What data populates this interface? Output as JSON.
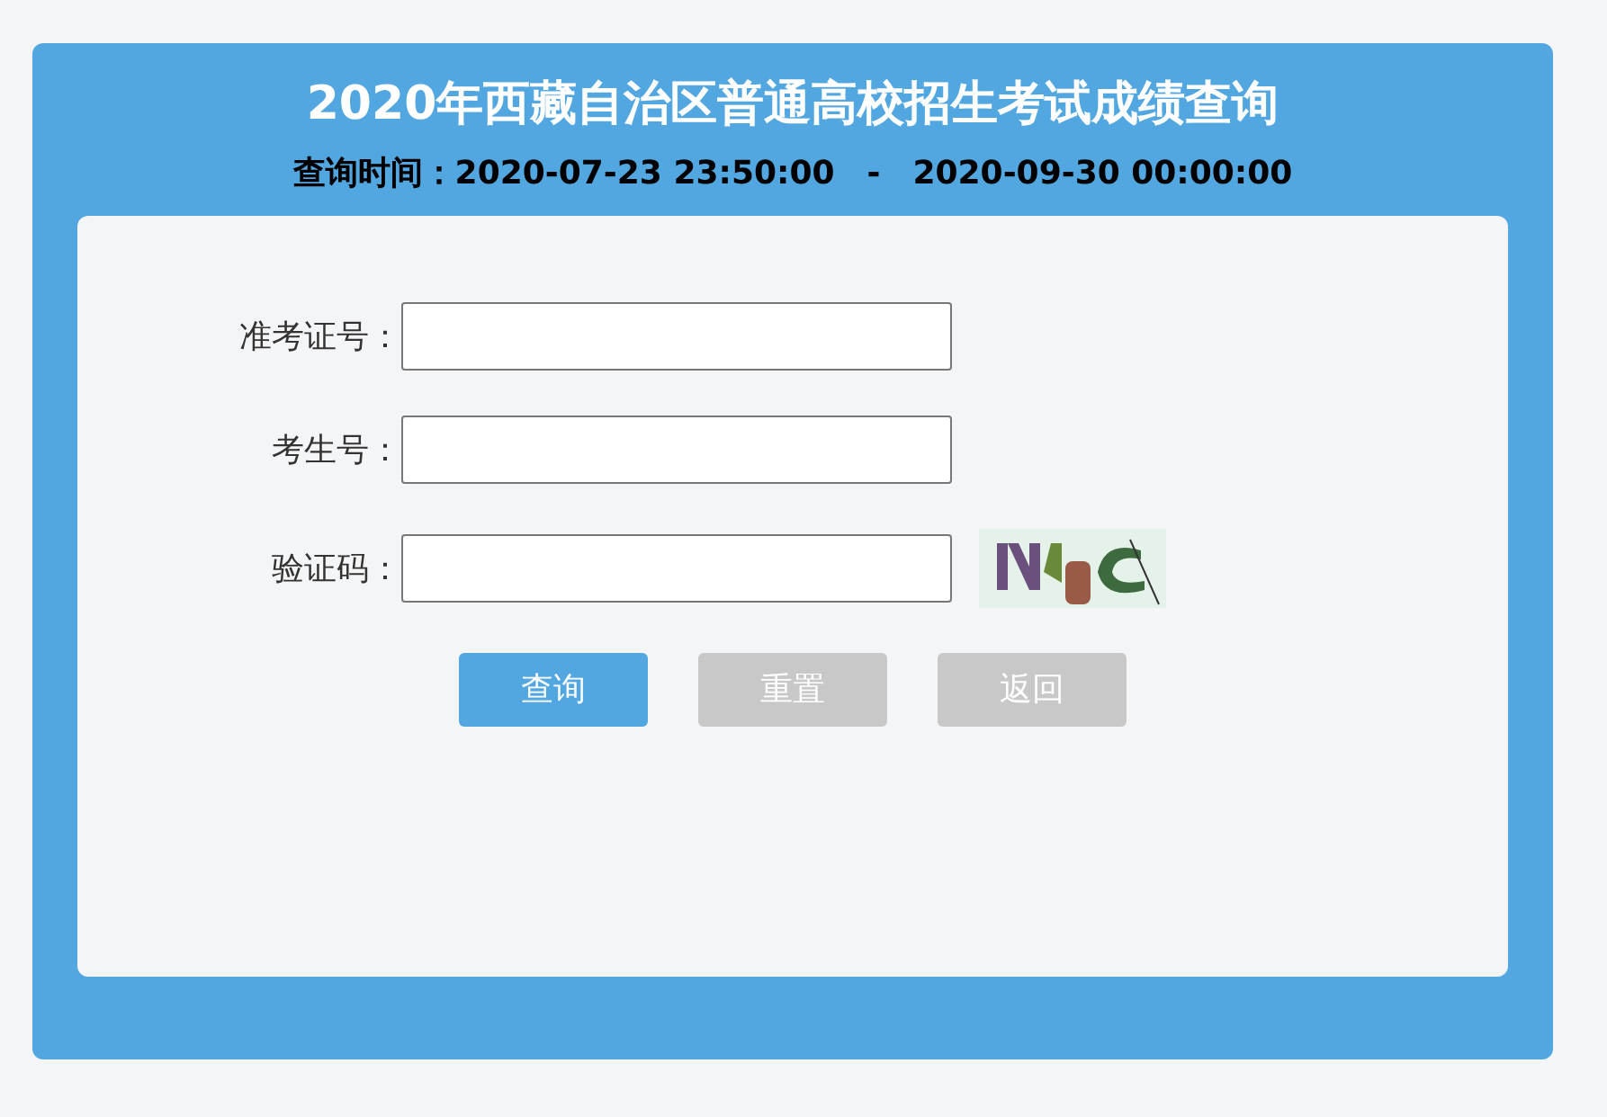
{
  "title": "2020年西藏自治区普通高校招生考试成绩查询",
  "query_period": {
    "label": "查询时间：",
    "start": "2020-07-23 23:50:00",
    "separator": "-",
    "end": "2020-09-30 00:00:00"
  },
  "fields": [
    {
      "label": "准考证号："
    },
    {
      "label": "考生号："
    },
    {
      "label": "验证码："
    }
  ],
  "buttons": [
    {
      "label": "查询",
      "kind": "primary"
    },
    {
      "label": "重置",
      "kind": "secondary"
    },
    {
      "label": "返回",
      "kind": "secondary"
    }
  ]
}
